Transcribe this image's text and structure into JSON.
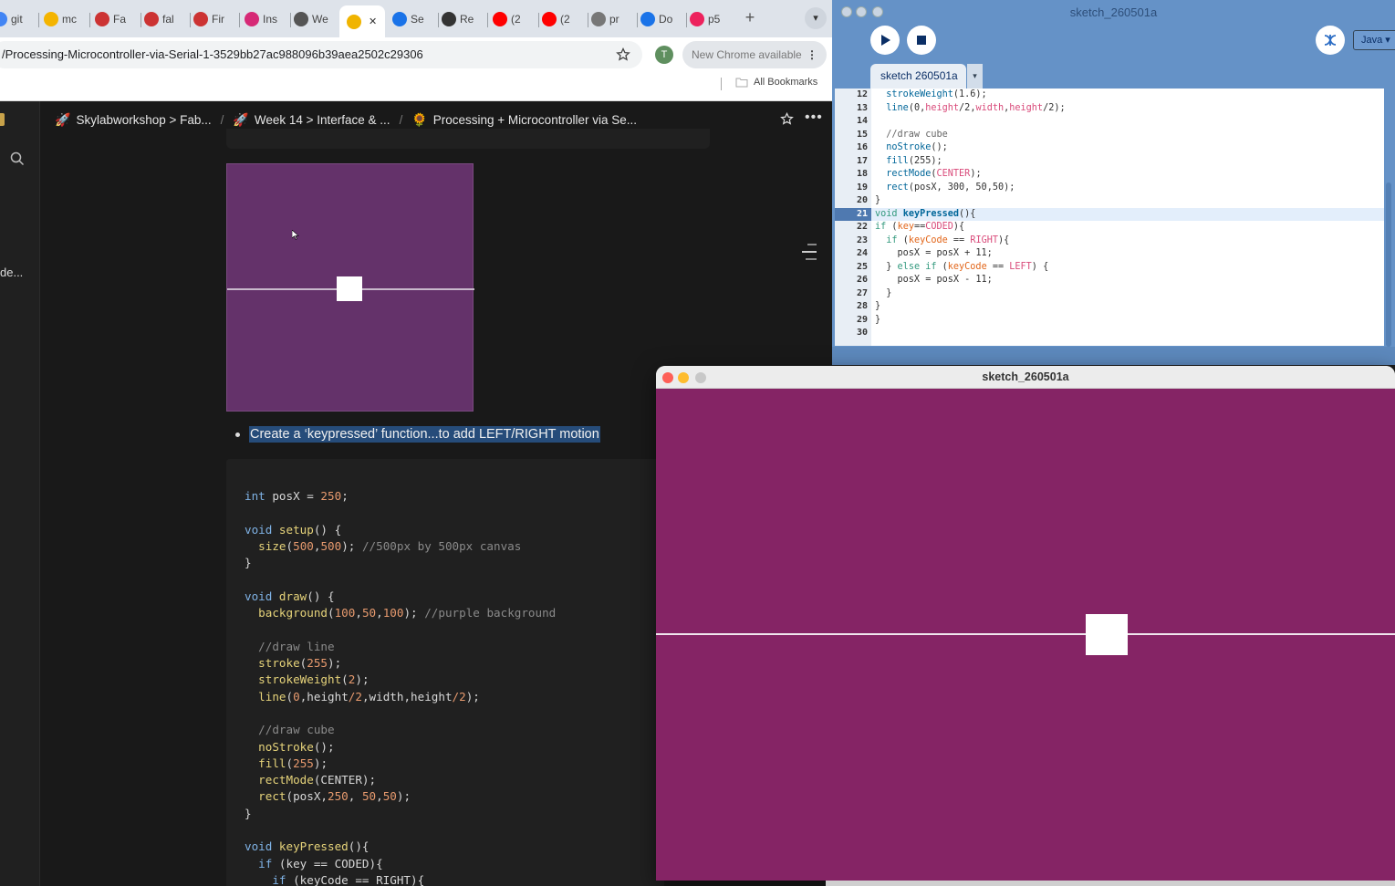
{
  "chrome": {
    "tabs": [
      {
        "label": "git",
        "color": "#4285f4"
      },
      {
        "label": "mc",
        "color": "#f4b400"
      },
      {
        "label": "Fa",
        "color": "#c33"
      },
      {
        "label": "fal",
        "color": "#c33"
      },
      {
        "label": "Fir",
        "color": "#c33"
      },
      {
        "label": "Ins",
        "color": "#d62976"
      },
      {
        "label": "We",
        "color": "#555"
      },
      {
        "label": "",
        "color": "#f0b400",
        "active": true
      },
      {
        "label": "Se",
        "color": "#1a73e8"
      },
      {
        "label": "Re",
        "color": "#333"
      },
      {
        "label": "(2",
        "color": "#f00"
      },
      {
        "label": "(2",
        "color": "#f00"
      },
      {
        "label": "pr",
        "color": "#777"
      },
      {
        "label": "Do",
        "color": "#1a73e8"
      },
      {
        "label": "p5",
        "color": "#ed225d"
      }
    ],
    "url": "/Processing-Microcontroller-via-Serial-1-3529bb27ac988096b39aea2502c29306",
    "avatar_letter": "T",
    "update_label": "New Chrome available",
    "bookmarks_label": "All Bookmarks"
  },
  "notion": {
    "breadcrumbs": [
      {
        "icon": "🚀",
        "label": "Skylabworkshop > Fab..."
      },
      {
        "icon": "🚀",
        "label": "Week 14 > Interface & ..."
      },
      {
        "icon": "🌻",
        "label": "Processing + Microcontroller via Se..."
      }
    ],
    "sidebar_snippet": "de...",
    "bullet_text": "Create a ‘keypressed’ function...to add LEFT/RIGHT motion",
    "code_lines": [
      [
        [
          "kw",
          "int"
        ],
        [
          "op",
          " posX "
        ],
        [
          "op",
          "="
        ],
        [
          "num",
          " 250"
        ],
        [
          "op",
          ";"
        ]
      ],
      [],
      [
        [
          "kw",
          "void"
        ],
        [
          "fn",
          " setup"
        ],
        [
          "op",
          "() {"
        ]
      ],
      [
        [
          "op",
          "  "
        ],
        [
          "fn",
          "size"
        ],
        [
          "op",
          "("
        ],
        [
          "num",
          "500"
        ],
        [
          "op",
          ","
        ],
        [
          "num",
          "500"
        ],
        [
          "op",
          "); "
        ],
        [
          "cm",
          "//500px by 500px canvas"
        ]
      ],
      [
        [
          "op",
          "}"
        ]
      ],
      [],
      [
        [
          "kw",
          "void"
        ],
        [
          "fn",
          " draw"
        ],
        [
          "op",
          "() {"
        ]
      ],
      [
        [
          "op",
          "  "
        ],
        [
          "fn",
          "background"
        ],
        [
          "op",
          "("
        ],
        [
          "num",
          "100"
        ],
        [
          "op",
          ","
        ],
        [
          "num",
          "50"
        ],
        [
          "op",
          ","
        ],
        [
          "num",
          "100"
        ],
        [
          "op",
          "); "
        ],
        [
          "cm",
          "//purple background"
        ]
      ],
      [],
      [
        [
          "cm",
          "  //draw line"
        ]
      ],
      [
        [
          "op",
          "  "
        ],
        [
          "fn",
          "stroke"
        ],
        [
          "op",
          "("
        ],
        [
          "num",
          "255"
        ],
        [
          "op",
          ");"
        ]
      ],
      [
        [
          "op",
          "  "
        ],
        [
          "fn",
          "strokeWeight"
        ],
        [
          "op",
          "("
        ],
        [
          "num",
          "2"
        ],
        [
          "op",
          ");"
        ]
      ],
      [
        [
          "op",
          "  "
        ],
        [
          "fn",
          "line"
        ],
        [
          "op",
          "("
        ],
        [
          "num",
          "0"
        ],
        [
          "op",
          ",height"
        ],
        [
          "num",
          "/2"
        ],
        [
          "op",
          ",width,height"
        ],
        [
          "num",
          "/2"
        ],
        [
          "op",
          ");"
        ]
      ],
      [],
      [
        [
          "cm",
          "  //draw cube"
        ]
      ],
      [
        [
          "op",
          "  "
        ],
        [
          "fn",
          "noStroke"
        ],
        [
          "op",
          "();"
        ]
      ],
      [
        [
          "op",
          "  "
        ],
        [
          "fn",
          "fill"
        ],
        [
          "op",
          "("
        ],
        [
          "num",
          "255"
        ],
        [
          "op",
          ");"
        ]
      ],
      [
        [
          "op",
          "  "
        ],
        [
          "fn",
          "rectMode"
        ],
        [
          "op",
          "(CENTER);"
        ]
      ],
      [
        [
          "op",
          "  "
        ],
        [
          "fn",
          "rect"
        ],
        [
          "op",
          "(posX,"
        ],
        [
          "num",
          "250"
        ],
        [
          "op",
          ", "
        ],
        [
          "num",
          "50"
        ],
        [
          "op",
          ","
        ],
        [
          "num",
          "50"
        ],
        [
          "op",
          ");"
        ]
      ],
      [
        [
          "op",
          "}"
        ]
      ],
      [],
      [
        [
          "kw",
          "void"
        ],
        [
          "fn",
          " keyPressed"
        ],
        [
          "op",
          "(){"
        ]
      ],
      [
        [
          "op",
          "  "
        ],
        [
          "kw",
          "if"
        ],
        [
          "op",
          " (key == CODED){"
        ]
      ],
      [
        [
          "op",
          "    "
        ],
        [
          "kw",
          "if"
        ],
        [
          "op",
          " (keyCode == RIGHT){"
        ]
      ]
    ]
  },
  "ide": {
    "title": "sketch_260501a",
    "tab_label": "sketch 260501a",
    "mode_label": "Java",
    "lines": [
      {
        "n": "12",
        "parts": [
          [
            "d",
            "  "
          ],
          [
            "pf",
            "strokeWeight"
          ],
          [
            "d",
            "(1.6);"
          ]
        ]
      },
      {
        "n": "13",
        "parts": [
          [
            "d",
            "  "
          ],
          [
            "pf",
            "line"
          ],
          [
            "d",
            "(0,"
          ],
          [
            "pb",
            "height"
          ],
          [
            "d",
            "/2,"
          ],
          [
            "pb",
            "width"
          ],
          [
            "d",
            ","
          ],
          [
            "pb",
            "height"
          ],
          [
            "d",
            "/2);"
          ]
        ]
      },
      {
        "n": "14",
        "parts": []
      },
      {
        "n": "15",
        "parts": [
          [
            "pc",
            "  //draw cube"
          ]
        ]
      },
      {
        "n": "16",
        "parts": [
          [
            "d",
            "  "
          ],
          [
            "pf",
            "noStroke"
          ],
          [
            "d",
            "();"
          ]
        ]
      },
      {
        "n": "17",
        "parts": [
          [
            "d",
            "  "
          ],
          [
            "pf",
            "fill"
          ],
          [
            "d",
            "(255);"
          ]
        ]
      },
      {
        "n": "18",
        "parts": [
          [
            "d",
            "  "
          ],
          [
            "pf",
            "rectMode"
          ],
          [
            "d",
            "("
          ],
          [
            "pb",
            "CENTER"
          ],
          [
            "d",
            ");"
          ]
        ]
      },
      {
        "n": "19",
        "parts": [
          [
            "d",
            "  "
          ],
          [
            "pf",
            "rect"
          ],
          [
            "d",
            "(posX, 300, 50,50);"
          ]
        ]
      },
      {
        "n": "20",
        "parts": [
          [
            "d",
            "}"
          ]
        ]
      },
      {
        "n": "21",
        "parts": [
          [
            "pk",
            "void"
          ],
          [
            "d",
            " "
          ],
          [
            "pf",
            "keyPressed"
          ],
          [
            "d",
            "(){"
          ]
        ],
        "current": true
      },
      {
        "n": "22",
        "parts": [
          [
            "pk",
            "if"
          ],
          [
            "d",
            " ("
          ],
          [
            "pv",
            "key"
          ],
          [
            "d",
            "=="
          ],
          [
            "pb",
            "CODED"
          ],
          [
            "d",
            "){"
          ]
        ]
      },
      {
        "n": "23",
        "parts": [
          [
            "d",
            "  "
          ],
          [
            "pk",
            "if"
          ],
          [
            "d",
            " ("
          ],
          [
            "pv",
            "keyCode"
          ],
          [
            "d",
            " == "
          ],
          [
            "pb",
            "RIGHT"
          ],
          [
            "d",
            "){"
          ]
        ]
      },
      {
        "n": "24",
        "parts": [
          [
            "d",
            "    posX = posX + 11;"
          ]
        ]
      },
      {
        "n": "25",
        "parts": [
          [
            "d",
            "  } "
          ],
          [
            "pk",
            "else if"
          ],
          [
            "d",
            " ("
          ],
          [
            "pv",
            "keyCode"
          ],
          [
            "d",
            " == "
          ],
          [
            "pb",
            "LEFT"
          ],
          [
            "d",
            ") {"
          ]
        ]
      },
      {
        "n": "26",
        "parts": [
          [
            "d",
            "    posX = posX - 11;"
          ]
        ]
      },
      {
        "n": "27",
        "parts": [
          [
            "d",
            "  }"
          ]
        ]
      },
      {
        "n": "28",
        "parts": [
          [
            "d",
            "}"
          ]
        ]
      },
      {
        "n": "29",
        "parts": [
          [
            "d",
            "}"
          ]
        ]
      },
      {
        "n": "30",
        "parts": []
      }
    ]
  },
  "sketch_window": {
    "title": "sketch_260501a"
  },
  "colors": {
    "sketch_bg": "#852465",
    "preview_bg": "#64326a",
    "ide_blue": "#6592c7"
  }
}
